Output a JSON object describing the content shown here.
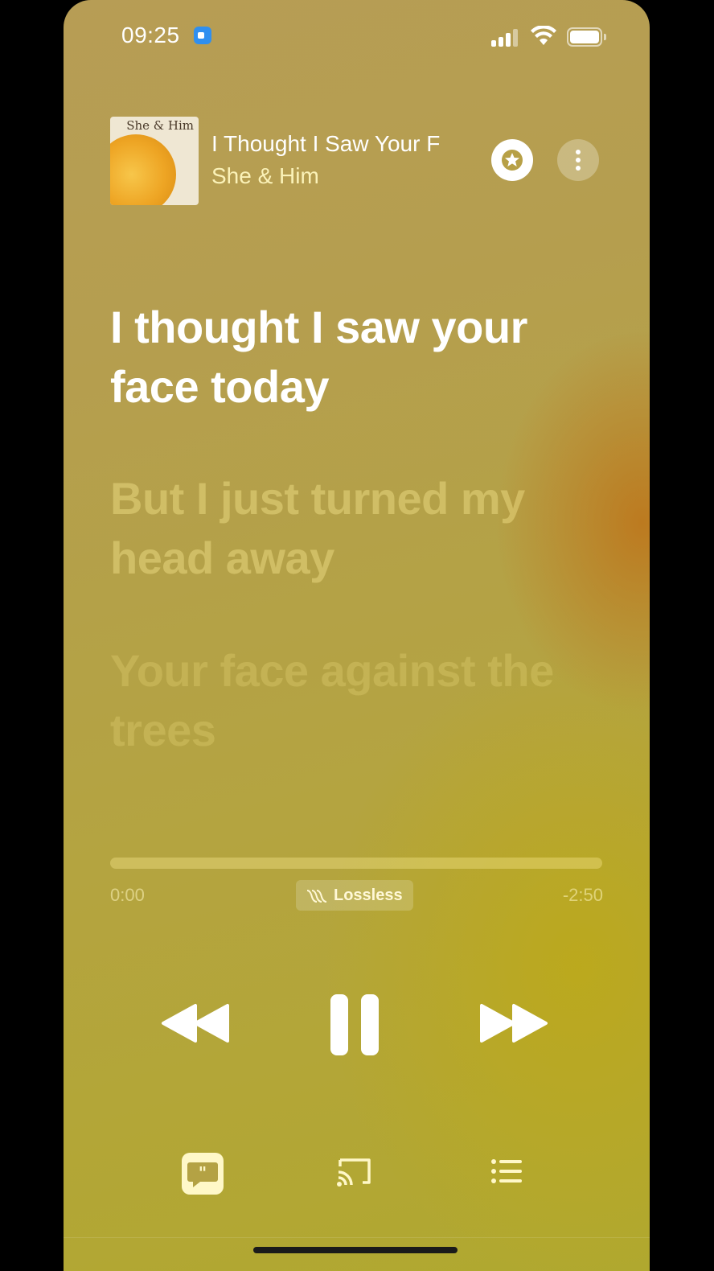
{
  "status_bar": {
    "time": "09:25",
    "icons": [
      "facetime-icon",
      "signal-icon",
      "wifi-icon",
      "battery-icon"
    ]
  },
  "now_playing": {
    "title": "I Thought I Saw Your F",
    "artist": "She & Him",
    "album_art_text": "She & Him",
    "favorite_icon": "star-icon",
    "more_icon": "ellipsis-vertical-icon"
  },
  "lyrics": {
    "line1": "I thought I saw your face today",
    "line2": "But I just turned my head away",
    "line3": "Your face against the trees"
  },
  "playback": {
    "elapsed": "0:00",
    "remaining": "-2:50",
    "progress_fraction": 0.0,
    "quality_badge": "Lossless"
  },
  "controls": {
    "rewind_icon": "rewind-icon",
    "pause_icon": "pause-icon",
    "forward_icon": "fast-forward-icon"
  },
  "bottom_bar": {
    "icons": [
      "lyrics-icon",
      "airplay-icon",
      "queue-list-icon"
    ]
  },
  "colors": {
    "background": "#b5a047",
    "accent_orange": "#be7319",
    "lyric_active": "#ffffff"
  }
}
